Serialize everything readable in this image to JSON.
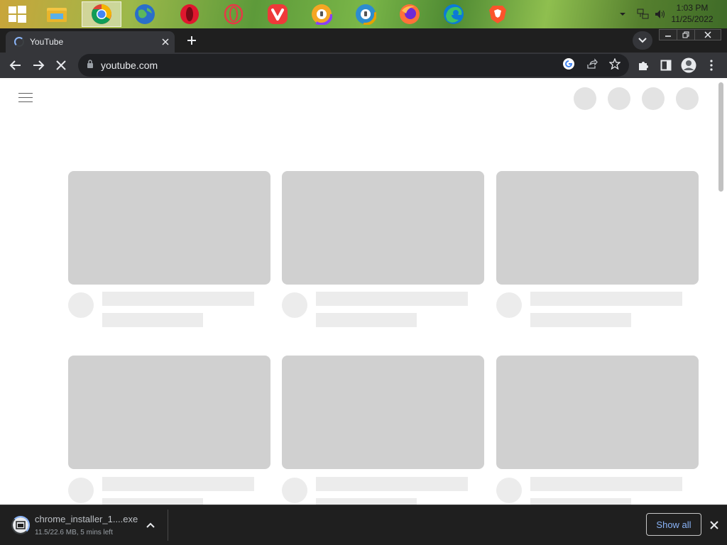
{
  "taskbar": {
    "apps": [
      {
        "icon": "windows-start-icon"
      },
      {
        "icon": "file-explorer-icon"
      },
      {
        "icon": "chrome-icon"
      },
      {
        "icon": "globe-browser-icon"
      },
      {
        "icon": "opera-icon"
      },
      {
        "icon": "opera-gx-icon"
      },
      {
        "icon": "vivaldi-icon"
      },
      {
        "icon": "avast-browser-icon"
      },
      {
        "icon": "avg-browser-icon"
      },
      {
        "icon": "firefox-icon"
      },
      {
        "icon": "edge-icon"
      },
      {
        "icon": "brave-icon"
      }
    ],
    "clock": {
      "time": "1:03 PM",
      "date": "11/25/2022"
    }
  },
  "browser": {
    "tab_title": "YouTube",
    "url": "youtube.com",
    "colors": {
      "frame": "#1f1f1f",
      "toolbar": "#35363a",
      "omnibox": "#202124",
      "accent": "#8ab4f8"
    }
  },
  "page": {
    "skeleton_color": "#d0d0d0"
  },
  "download": {
    "filename": "chrome_installer_1....exe",
    "status": "11.5/22.6 MB, 5 mins left",
    "show_all_label": "Show all"
  }
}
